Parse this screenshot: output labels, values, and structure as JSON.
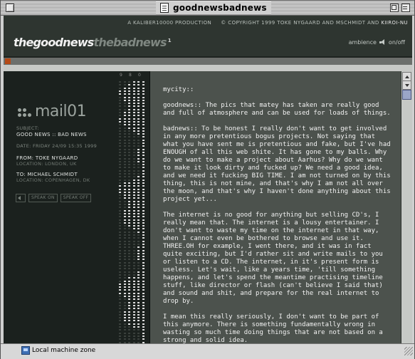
{
  "window": {
    "title": "goodnewsbadnews"
  },
  "header": {
    "credits_prefix": "A KALIBER10000 PRODUCTION",
    "credits_main": "© COPYRIGHT 1999 TOKE NYGAARD AND MSCHMIDT AND",
    "credits_suffix": "KIIROI-NU",
    "logo_good": "thegoodnews",
    "logo_bad": "thebadnews",
    "logo_super": "1",
    "ambience_label": "ambience",
    "ambience_toggle": "on/off"
  },
  "mail": {
    "title": "mail01",
    "subject_label": "SUBJECT:",
    "subject_value": "GOOD NEWS :: BAD NEWS",
    "date": "DATE:  FRIDAY 24/09 15:35 1999",
    "from_value": "FROM: TOKE NYGAARD",
    "from_location": "LOCATION: LONDON, UK",
    "to_value": "TO: MICHAEL SCHMIDT",
    "to_location": "LOCATION: COPENHAGEN, DK",
    "speak_on": "SPEAK ON",
    "speak_off": "SPEAK OFF"
  },
  "visualizer": {
    "labels": [
      "9",
      "8",
      "0"
    ]
  },
  "message": {
    "paragraphs": [
      "mycity::",
      "goodnews:: The pics that matey has taken are really good and full of atmosphere and can be used for loads of things.",
      "badnews:: To be honest I really don't want to get involved in any more pretentious bogus projects. Not saying that what you have sent me is pretentious and fake, but I've had ENOUGH of all this web shite. It has gone to my balls. Why do we want to make a project about Aarhus? Why do we want to make it look dirty and fucked up? We need a good idea, and we need it fucking BIG TIME. I am not turned on by this thing, this is not mine, and that's why I am not all over the moon, and that's why I haven't done anything about this project yet...",
      "The internet is no good for anything but selling CD's, I really mean that. The internet is a lousy entertainer. I don't want to waste my time on the internet in that way, when I cannot even be bothered to browse and use it. THREE.OH for example, I went there, and it was in fact quite exciting, but I'd rather sit and write mails to you or listen to a CD. The internet, in it's present form is useless. Let's wait, like a years time, 'till something happens, and let's spend the meantime practising timeline stuff, like director or flash (can't believe I said that) and sound and shit, and prepare for the real internet to drop by.",
      "I mean this really seriously, I don't want to be part of this anymore. There is something fundamentally wrong in wasting so much time doing things that are not based on a strong and solid idea."
    ]
  },
  "status": {
    "zone": "Local machine zone"
  },
  "colors": {
    "accent": "#b54a17",
    "panel_dark": "#1b211e",
    "panel_text": "#4c524d"
  }
}
